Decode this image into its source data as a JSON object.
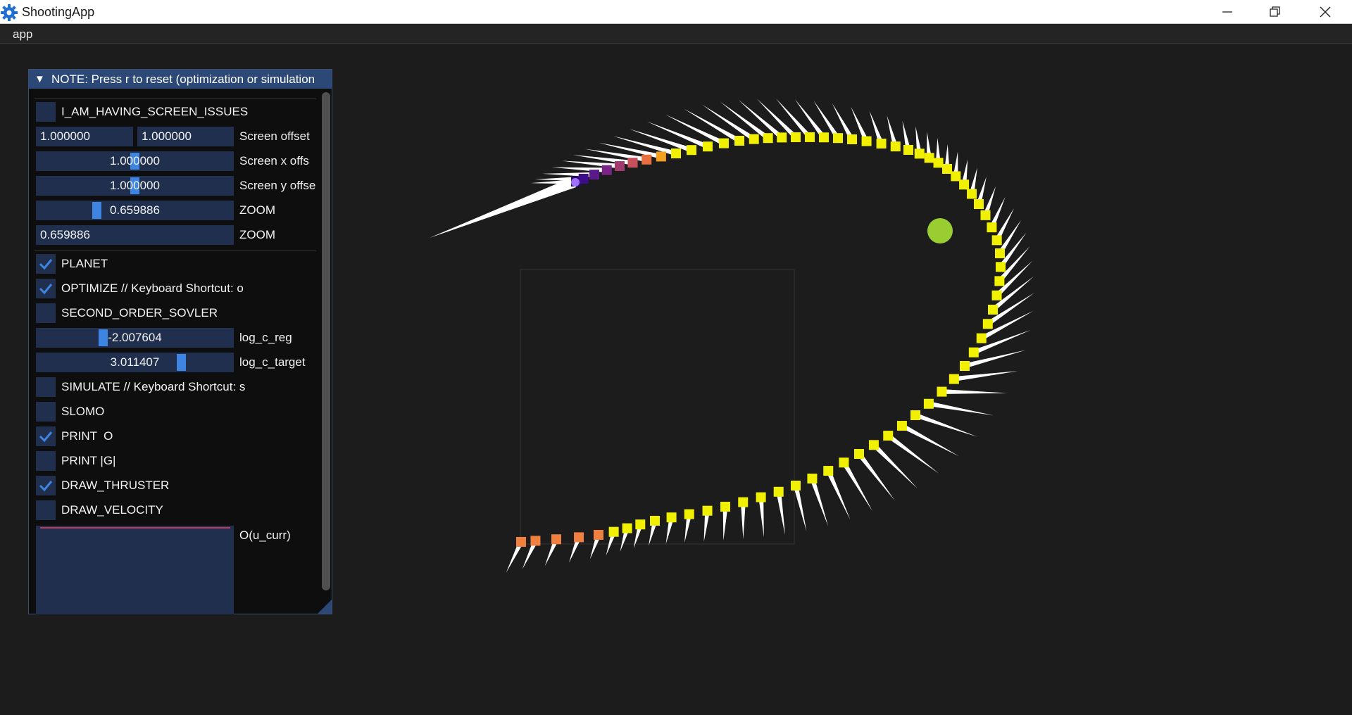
{
  "window": {
    "title": "ShootingApp",
    "icon": "gear-icon",
    "controls": [
      "minimize-icon",
      "restore-icon",
      "close-icon"
    ]
  },
  "menubar": {
    "items": [
      "app"
    ]
  },
  "panel": {
    "title": "NOTE: Press r to reset (optimization or simulation",
    "collapse_icon": "triangle-down-icon",
    "screen_issues": {
      "label": "I_AM_HAVING_SCREEN_ISSUES",
      "checked": false
    },
    "screen_offset": {
      "x": "1.000000",
      "y": "1.000000",
      "label": "Screen offset"
    },
    "screen_x_offset": {
      "value": "1.000000",
      "label": "Screen x offs",
      "fraction": 0.5
    },
    "screen_y_offset": {
      "value": "1.000000",
      "label": "Screen y offse",
      "fraction": 0.5
    },
    "zoom_slider": {
      "value": "0.659886",
      "label": "ZOOM",
      "fraction": 0.28
    },
    "zoom_input": {
      "value": "0.659886",
      "label": "ZOOM"
    },
    "planet": {
      "label": "PLANET",
      "checked": true
    },
    "optimize": {
      "label": "OPTIMIZE // Keyboard Shortcut: o",
      "checked": true
    },
    "second_order": {
      "label": "SECOND_ORDER_SOVLER",
      "checked": false
    },
    "log_c_reg": {
      "value": "-2.007604",
      "label": "log_c_reg",
      "fraction": 0.3
    },
    "log_c_target": {
      "value": "3.011407",
      "label": "log_c_target",
      "fraction": 0.65
    },
    "simulate": {
      "label": "SIMULATE // Keyboard Shortcut: s",
      "checked": false
    },
    "slomo": {
      "label": "SLOMO",
      "checked": false
    },
    "print_o": {
      "label": "PRINT  O",
      "checked": true
    },
    "print_g": {
      "label": "PRINT |G|",
      "checked": false
    },
    "draw_thruster": {
      "label": "DRAW_THRUSTER",
      "checked": true
    },
    "draw_velocity": {
      "label": "DRAW_VELOCITY",
      "checked": false
    },
    "plot": {
      "label": "O(u_curr)"
    }
  },
  "colors": {
    "background": "#1c1c1c",
    "panel_header": "#2c4876",
    "frame": "#1f2f4d",
    "check": "#3d85e0",
    "trajectory": "#f0f000",
    "planet": "#9acd32",
    "thruster": "#ffffff"
  }
}
